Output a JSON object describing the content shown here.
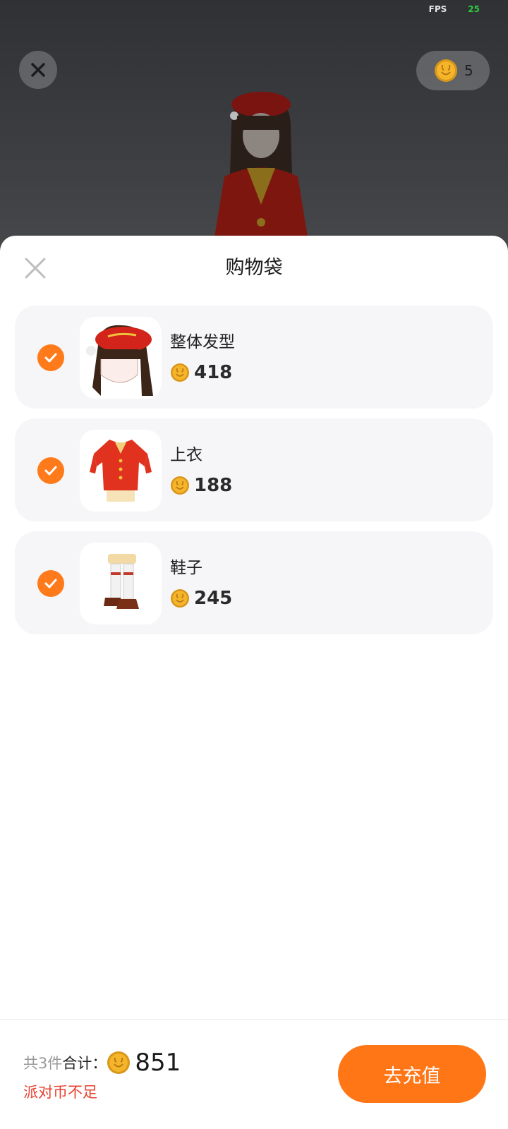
{
  "status": {
    "fps_label": "FPS",
    "fps_value": "25"
  },
  "header": {
    "coin_balance": "5"
  },
  "sheet": {
    "title": "购物袋",
    "items": [
      {
        "name": "整体发型",
        "price": "418",
        "checked": true,
        "thumb_icon": "hairstyle-thumbnail"
      },
      {
        "name": "上衣",
        "price": "188",
        "checked": true,
        "thumb_icon": "top-clothing-thumbnail"
      },
      {
        "name": "鞋子",
        "price": "245",
        "checked": true,
        "thumb_icon": "shoes-thumbnail"
      }
    ]
  },
  "footer": {
    "item_count": "共3件",
    "total_label": "合计：",
    "total_value": "851",
    "warning": "派对币不足",
    "recharge_label": "去充值"
  },
  "colors": {
    "accent": "#ff7617",
    "warning": "#e8402f",
    "coin": "#f5b52a"
  }
}
